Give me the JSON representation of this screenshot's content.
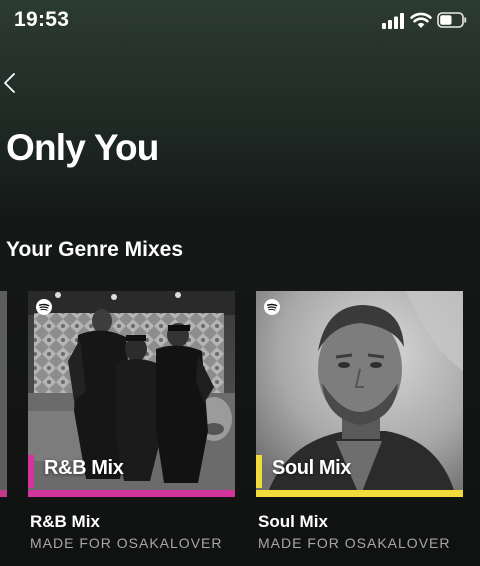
{
  "status": {
    "time": "19:53",
    "signal_icon": "signal-bars-icon",
    "wifi_icon": "wifi-icon",
    "battery_icon": "battery-icon",
    "battery_level": 0.55
  },
  "nav": {
    "back_icon": "chevron-left-icon"
  },
  "page": {
    "title": "Only You"
  },
  "section": {
    "title": "Your Genre Mixes"
  },
  "cards": [
    {
      "art_label": "R&B Mix",
      "name": "R&B Mix",
      "subtitle": "MADE FOR OSAKALOVER",
      "accent_color": "#d2359b",
      "logo_icon": "spotify-logo-icon"
    },
    {
      "art_label": "Soul Mix",
      "name": "Soul Mix",
      "subtitle": "MADE FOR OSAKALOVER",
      "accent_color": "#f2dc3b",
      "logo_icon": "spotify-logo-icon"
    }
  ]
}
